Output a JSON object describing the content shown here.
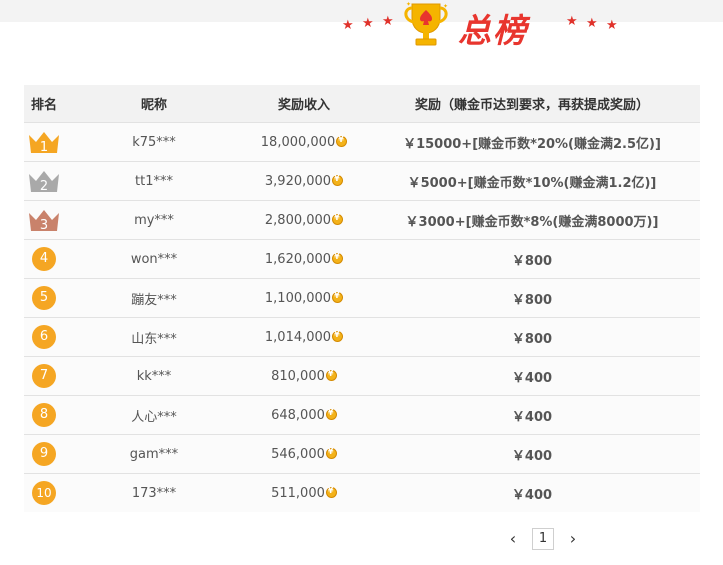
{
  "header": {
    "title": "总榜"
  },
  "table": {
    "headers": {
      "rank": "排名",
      "nickname": "昵称",
      "income": "奖励收入",
      "reward": "奖励（赚金币达到要求，再获提成奖励）"
    },
    "rows": [
      {
        "rank": "1",
        "nickname": "k75***",
        "income": "18,000,000",
        "reward": "￥15000+[赚金币数*20%(赚金满2.5亿)]"
      },
      {
        "rank": "2",
        "nickname": "tt1***",
        "income": "3,920,000",
        "reward": "￥5000+[赚金币数*10%(赚金满1.2亿)]"
      },
      {
        "rank": "3",
        "nickname": "my***",
        "income": "2,800,000",
        "reward": "￥3000+[赚金币数*8%(赚金满8000万)]"
      },
      {
        "rank": "4",
        "nickname": "won***",
        "income": "1,620,000",
        "reward": "￥800"
      },
      {
        "rank": "5",
        "nickname": "蹦友***",
        "income": "1,100,000",
        "reward": "￥800"
      },
      {
        "rank": "6",
        "nickname": "山东***",
        "income": "1,014,000",
        "reward": "￥800"
      },
      {
        "rank": "7",
        "nickname": "kk***",
        "income": "810,000",
        "reward": "￥400"
      },
      {
        "rank": "8",
        "nickname": "人心***",
        "income": "648,000",
        "reward": "￥400"
      },
      {
        "rank": "9",
        "nickname": "gam***",
        "income": "546,000",
        "reward": "￥400"
      },
      {
        "rank": "10",
        "nickname": "173***",
        "income": "511,000",
        "reward": "￥400"
      }
    ]
  },
  "pagination": {
    "current": "1",
    "prev_icon": "chevron-left-icon",
    "next_icon": "chevron-right-icon"
  },
  "colors": {
    "accent": "#e8352e",
    "gold": "#f5a623",
    "silver": "#a9a9a9",
    "bronze": "#c9826b"
  }
}
